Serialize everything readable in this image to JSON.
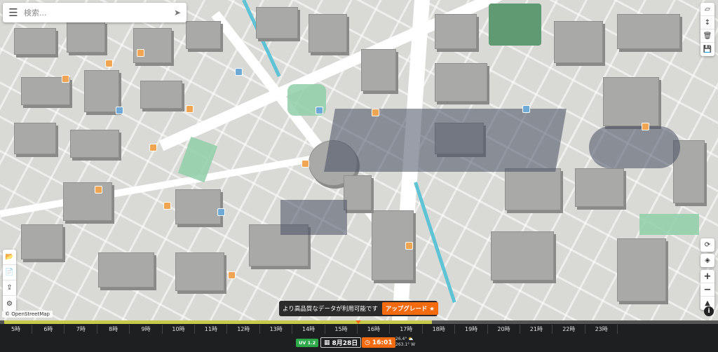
{
  "search": {
    "placeholder": "検索..."
  },
  "map": {
    "attribution": "© OpenStreetMap",
    "colors": {
      "building": "#a9a9a7",
      "park": "#8fcfa8",
      "water": "#5fc3d6",
      "shadow": "#464e62",
      "road": "#ffffff",
      "background": "#d9d9d5"
    },
    "right_toolbar_top": [
      "draw-polygon-icon",
      "vertical-resize-icon",
      "trash-icon",
      "save-icon"
    ],
    "right_toolbar_bottom": [
      "compass-rotate-icon",
      "layers-icon",
      "zoom-in-icon",
      "zoom-out-icon",
      "north-arrow-icon"
    ],
    "left_toolbar": [
      "folder-icon",
      "file-export-icon",
      "share-icon",
      "settings-icon"
    ]
  },
  "banner": {
    "message": "より高品質なデータが利用可能です",
    "upgrade_label": "アップグレード ★"
  },
  "timeline": {
    "hours": [
      "5時",
      "6時",
      "7時",
      "8時",
      "9時",
      "10時",
      "11時",
      "12時",
      "13時",
      "14時",
      "15時",
      "16時",
      "17時",
      "18時",
      "19時",
      "20時",
      "21時",
      "22時",
      "23時"
    ],
    "uv_label": "UV 1.2",
    "date": "8月28日",
    "time": "16:01",
    "sun_altitude": "26.4° ⛅",
    "sun_azimuth": "263.1° W",
    "accent": "#f46b0f",
    "daylight_color": "#c7c94a"
  }
}
